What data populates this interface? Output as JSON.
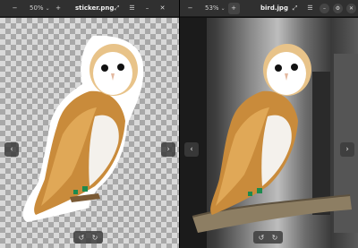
{
  "left": {
    "zoom": "50%",
    "title": "sticker.png",
    "icons": [
      "minus-icon",
      "plus-icon",
      "menu-icon",
      "fullscreen-icon",
      "close-icon"
    ]
  },
  "right": {
    "zoom": "53%",
    "title": "bird.jpg",
    "icons": [
      "minus-icon",
      "plus-icon",
      "fullscreen-icon",
      "menu-icon",
      "minimize-icon",
      "settings-icon",
      "close-icon"
    ]
  },
  "nav": {
    "prev": "‹",
    "next": "›"
  },
  "rotate": {
    "ccw": "↺",
    "cw": "↻"
  }
}
